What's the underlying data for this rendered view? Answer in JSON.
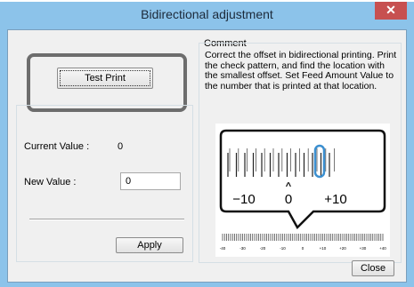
{
  "window": {
    "title": "Bidirectional adjustment",
    "close_symbol": "✕"
  },
  "buttons": {
    "test_print": "Test Print",
    "apply": "Apply",
    "close": "Close"
  },
  "values": {
    "current_label": "Current Value :",
    "current_value": "0",
    "new_label": "New Value :",
    "new_value": "0"
  },
  "comment": {
    "title": "Comment",
    "text": "Correct the offset in bidirectional printing. Print the check pattern, and find the location with the smallest offset. Set Feed Amount Value to the number that is printed at that location."
  },
  "illustration": {
    "big_labels": [
      "−10",
      "0",
      "+10"
    ],
    "caret": "^",
    "scale_labels": [
      "-40",
      "-30",
      "-20",
      "-10",
      "0",
      "+10",
      "+20",
      "+30",
      "+40"
    ],
    "highlight_color": "#3b8fd0"
  },
  "colors": {
    "title_bar": "#8cc3ea",
    "close_button": "#c75050",
    "highlight_ring": "#6d6d6d"
  }
}
